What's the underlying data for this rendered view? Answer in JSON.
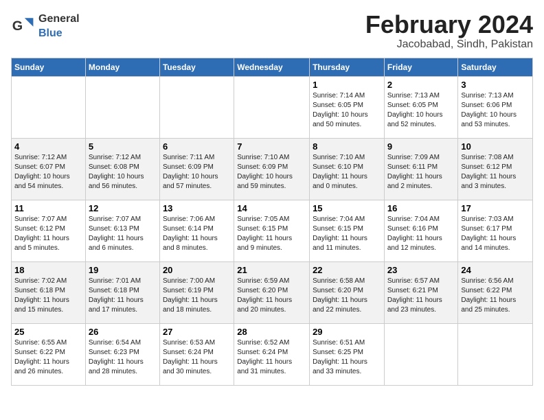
{
  "header": {
    "logo_general": "General",
    "logo_blue": "Blue",
    "month_title": "February 2024",
    "location": "Jacobabad, Sindh, Pakistan"
  },
  "days_of_week": [
    "Sunday",
    "Monday",
    "Tuesday",
    "Wednesday",
    "Thursday",
    "Friday",
    "Saturday"
  ],
  "weeks": [
    [
      {
        "day": "",
        "info": ""
      },
      {
        "day": "",
        "info": ""
      },
      {
        "day": "",
        "info": ""
      },
      {
        "day": "",
        "info": ""
      },
      {
        "day": "1",
        "info": "Sunrise: 7:14 AM\nSunset: 6:05 PM\nDaylight: 10 hours\nand 50 minutes."
      },
      {
        "day": "2",
        "info": "Sunrise: 7:13 AM\nSunset: 6:05 PM\nDaylight: 10 hours\nand 52 minutes."
      },
      {
        "day": "3",
        "info": "Sunrise: 7:13 AM\nSunset: 6:06 PM\nDaylight: 10 hours\nand 53 minutes."
      }
    ],
    [
      {
        "day": "4",
        "info": "Sunrise: 7:12 AM\nSunset: 6:07 PM\nDaylight: 10 hours\nand 54 minutes."
      },
      {
        "day": "5",
        "info": "Sunrise: 7:12 AM\nSunset: 6:08 PM\nDaylight: 10 hours\nand 56 minutes."
      },
      {
        "day": "6",
        "info": "Sunrise: 7:11 AM\nSunset: 6:09 PM\nDaylight: 10 hours\nand 57 minutes."
      },
      {
        "day": "7",
        "info": "Sunrise: 7:10 AM\nSunset: 6:09 PM\nDaylight: 10 hours\nand 59 minutes."
      },
      {
        "day": "8",
        "info": "Sunrise: 7:10 AM\nSunset: 6:10 PM\nDaylight: 11 hours\nand 0 minutes."
      },
      {
        "day": "9",
        "info": "Sunrise: 7:09 AM\nSunset: 6:11 PM\nDaylight: 11 hours\nand 2 minutes."
      },
      {
        "day": "10",
        "info": "Sunrise: 7:08 AM\nSunset: 6:12 PM\nDaylight: 11 hours\nand 3 minutes."
      }
    ],
    [
      {
        "day": "11",
        "info": "Sunrise: 7:07 AM\nSunset: 6:12 PM\nDaylight: 11 hours\nand 5 minutes."
      },
      {
        "day": "12",
        "info": "Sunrise: 7:07 AM\nSunset: 6:13 PM\nDaylight: 11 hours\nand 6 minutes."
      },
      {
        "day": "13",
        "info": "Sunrise: 7:06 AM\nSunset: 6:14 PM\nDaylight: 11 hours\nand 8 minutes."
      },
      {
        "day": "14",
        "info": "Sunrise: 7:05 AM\nSunset: 6:15 PM\nDaylight: 11 hours\nand 9 minutes."
      },
      {
        "day": "15",
        "info": "Sunrise: 7:04 AM\nSunset: 6:15 PM\nDaylight: 11 hours\nand 11 minutes."
      },
      {
        "day": "16",
        "info": "Sunrise: 7:04 AM\nSunset: 6:16 PM\nDaylight: 11 hours\nand 12 minutes."
      },
      {
        "day": "17",
        "info": "Sunrise: 7:03 AM\nSunset: 6:17 PM\nDaylight: 11 hours\nand 14 minutes."
      }
    ],
    [
      {
        "day": "18",
        "info": "Sunrise: 7:02 AM\nSunset: 6:18 PM\nDaylight: 11 hours\nand 15 minutes."
      },
      {
        "day": "19",
        "info": "Sunrise: 7:01 AM\nSunset: 6:18 PM\nDaylight: 11 hours\nand 17 minutes."
      },
      {
        "day": "20",
        "info": "Sunrise: 7:00 AM\nSunset: 6:19 PM\nDaylight: 11 hours\nand 18 minutes."
      },
      {
        "day": "21",
        "info": "Sunrise: 6:59 AM\nSunset: 6:20 PM\nDaylight: 11 hours\nand 20 minutes."
      },
      {
        "day": "22",
        "info": "Sunrise: 6:58 AM\nSunset: 6:20 PM\nDaylight: 11 hours\nand 22 minutes."
      },
      {
        "day": "23",
        "info": "Sunrise: 6:57 AM\nSunset: 6:21 PM\nDaylight: 11 hours\nand 23 minutes."
      },
      {
        "day": "24",
        "info": "Sunrise: 6:56 AM\nSunset: 6:22 PM\nDaylight: 11 hours\nand 25 minutes."
      }
    ],
    [
      {
        "day": "25",
        "info": "Sunrise: 6:55 AM\nSunset: 6:22 PM\nDaylight: 11 hours\nand 26 minutes."
      },
      {
        "day": "26",
        "info": "Sunrise: 6:54 AM\nSunset: 6:23 PM\nDaylight: 11 hours\nand 28 minutes."
      },
      {
        "day": "27",
        "info": "Sunrise: 6:53 AM\nSunset: 6:24 PM\nDaylight: 11 hours\nand 30 minutes."
      },
      {
        "day": "28",
        "info": "Sunrise: 6:52 AM\nSunset: 6:24 PM\nDaylight: 11 hours\nand 31 minutes."
      },
      {
        "day": "29",
        "info": "Sunrise: 6:51 AM\nSunset: 6:25 PM\nDaylight: 11 hours\nand 33 minutes."
      },
      {
        "day": "",
        "info": ""
      },
      {
        "day": "",
        "info": ""
      }
    ]
  ]
}
